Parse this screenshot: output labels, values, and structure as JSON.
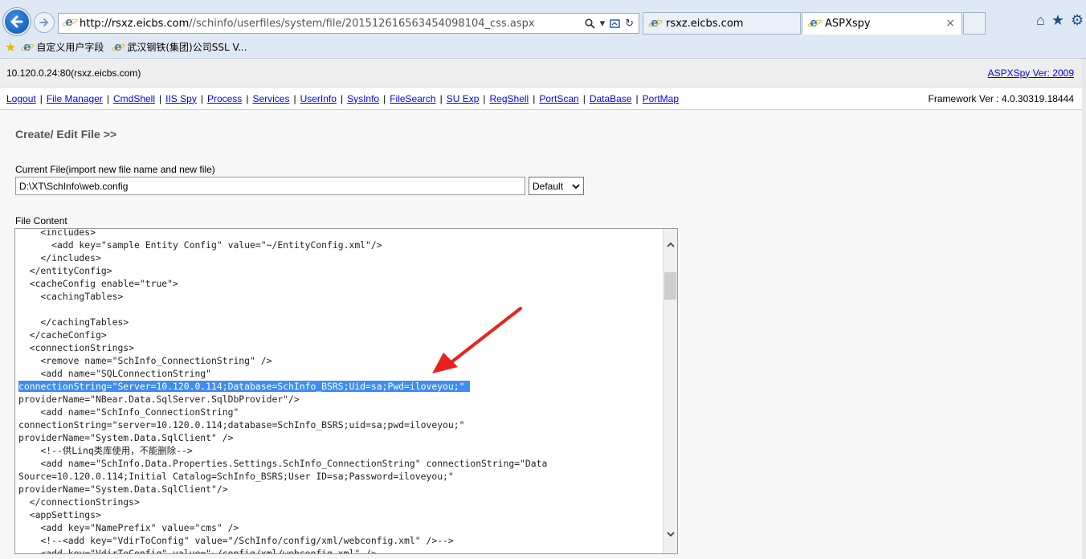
{
  "browser": {
    "url_host": "http://rsxz.eicbs.com",
    "url_path": "//schinfo/userfiles/system/file/201512616563454098104_css.aspx",
    "tabs": [
      {
        "label": "rsxz.eicbs.com"
      },
      {
        "label": "ASPXspy"
      }
    ],
    "favorites": [
      {
        "label": "自定义用户字段"
      },
      {
        "label": "武汉钢铁(集团)公司SSL V..."
      }
    ],
    "tab_close": "×"
  },
  "header": {
    "host": "10.120.0.24:80(rsxz.eicbs.com)",
    "version_link": "ASPXSpy Ver: 2009"
  },
  "menu": {
    "items": [
      "Logout",
      "File Manager",
      "CmdShell",
      "IIS Spy",
      "Process",
      "Services",
      "UserInfo",
      "SysInfo",
      "FileSearch",
      "SU Exp",
      "RegShell",
      "PortScan",
      "DataBase",
      "PortMap"
    ],
    "framework": "Framework Ver : 4.0.30319.18444"
  },
  "editor_form": {
    "title": "Create/ Edit File >>",
    "current_file_label": "Current File(import new file name and new file)",
    "current_file_value": "D:\\XT\\SchInfo\\web.config",
    "encoding": "Default",
    "file_content_label": "File Content",
    "lines": [
      "    <includes>",
      "      <add key=\"sample Entity Config\" value=\"~/EntityConfig.xml\"/>",
      "    </includes>",
      "  </entityConfig>",
      "  <cacheConfig enable=\"true\">",
      "    <cachingTables>",
      "",
      "    </cachingTables>",
      "  </cacheConfig>",
      "  <connectionStrings>",
      "    <remove name=\"SchInfo_ConnectionString\" />",
      "    <add name=\"SQLConnectionString\"",
      "connectionString=\"Server=10.120.0.114;Database=SchInfo_BSRS;Uid=sa;Pwd=iloveyou;\" ",
      "providerName=\"NBear.Data.SqlServer.SqlDbProvider\"/>",
      "    <add name=\"SchInfo_ConnectionString\"",
      "connectionString=\"server=10.120.0.114;database=SchInfo_BSRS;uid=sa;pwd=iloveyou;\"",
      "providerName=\"System.Data.SqlClient\" />",
      "    <!--供Linq类库使用，不能删除-->",
      "    <add name=\"SchInfo.Data.Properties.Settings.SchInfo_ConnectionString\" connectionString=\"Data",
      "Source=10.120.0.114;Initial Catalog=SchInfo_BSRS;User ID=sa;Password=iloveyou;\"",
      "providerName=\"System.Data.SqlClient\"/>",
      "  </connectionStrings>",
      "  <appSettings>",
      "    <add key=\"NamePrefix\" value=\"cms\" />",
      "    <!--<add key=\"VdirToConfig\" value=\"/SchInfo/config/xml/webconfig.xml\" />-->",
      "    <add key=\"VdirToConfig\" value=\"~/config/xml/webconfig.xml\" />"
    ],
    "highlighted_line": 12
  },
  "colors": {
    "selection": "#3f8df0",
    "annotation_arrow": "#e8231f",
    "link": "#0000ff"
  }
}
